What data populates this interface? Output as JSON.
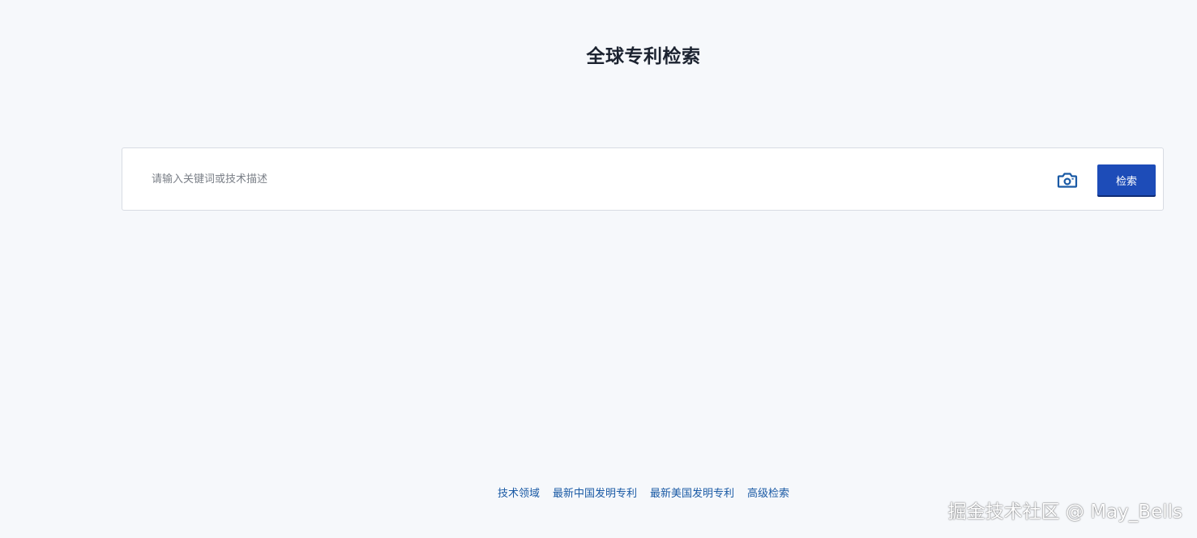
{
  "page": {
    "title": "全球专利检索"
  },
  "search": {
    "placeholder": "请输入关键词或技术描述",
    "button_label": "检索",
    "camera_icon": "camera-icon"
  },
  "footer": {
    "links": [
      "技术领域",
      "最新中国发明专利",
      "最新美国发明专利",
      "高级检索"
    ]
  },
  "watermark": {
    "text": "掘金技术社区 @ May_Bells"
  },
  "colors": {
    "background": "#f6f8fb",
    "primary": "#1d4cb8",
    "link": "#1a5aa5",
    "title": "#1c2330"
  }
}
